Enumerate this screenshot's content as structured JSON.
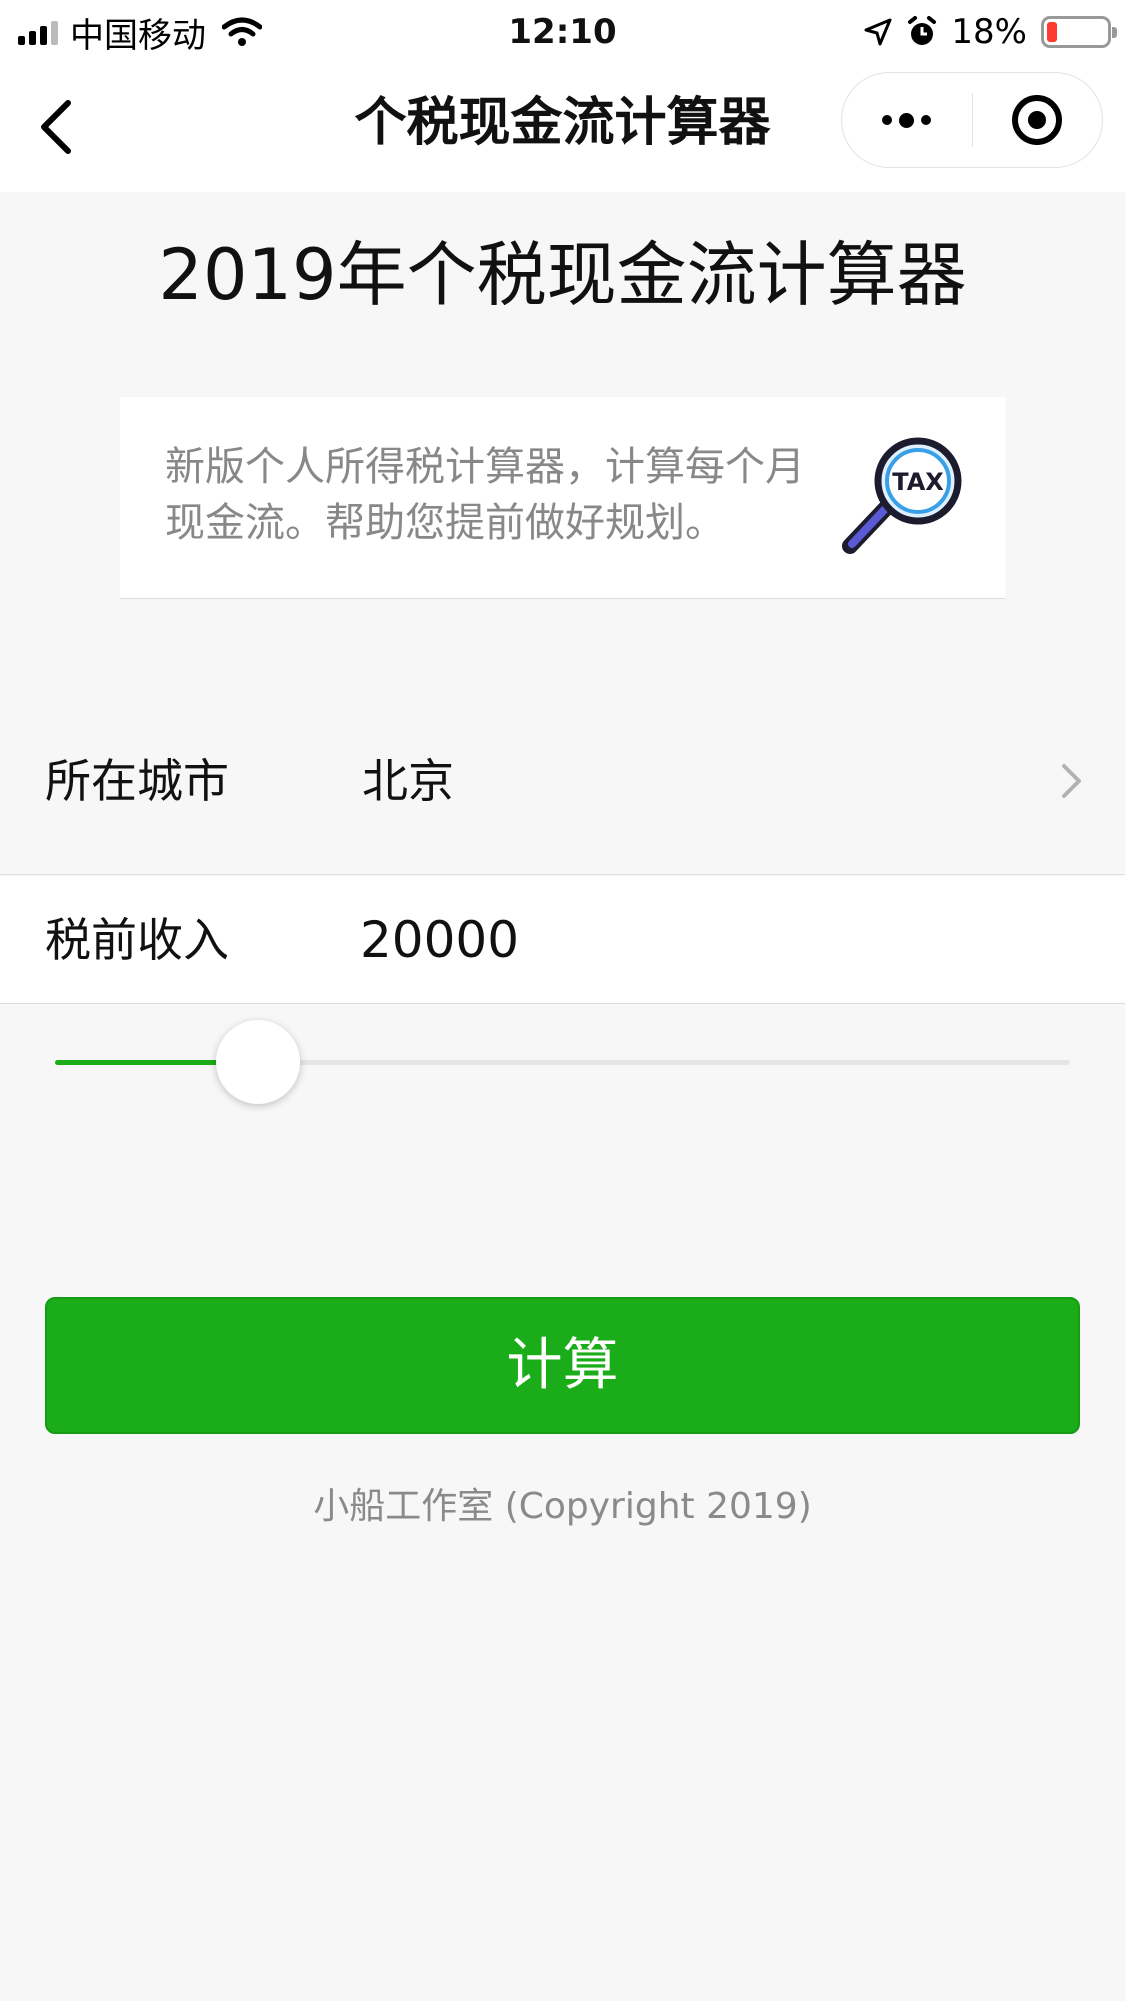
{
  "status_bar": {
    "carrier": "中国移动",
    "time": "12:10",
    "battery_percent": "18%",
    "battery_level": 0.18,
    "signal_bars": 3,
    "icons": [
      "signal-icon",
      "wifi-icon",
      "location-arrow-icon",
      "alarm-icon",
      "battery-icon"
    ]
  },
  "nav": {
    "title": "个税现金流计算器",
    "icons": [
      "back-icon",
      "more-icon",
      "close-target-icon"
    ]
  },
  "main": {
    "heading": "2019年个税现金流计算器",
    "intro": {
      "text": "新版个人所得税计算器，计算每个月现金流。帮助您提前做好规划。",
      "icon": "tax-magnifier-icon",
      "icon_label": "TAX"
    },
    "city": {
      "label": "所在城市",
      "value": "北京"
    },
    "income": {
      "label": "税前收入",
      "value": "20000"
    },
    "slider": {
      "fraction": 0.2
    },
    "calculate_label": "计算",
    "copyright": "小船工作室 (Copyright 2019)"
  },
  "colors": {
    "accent": "#1aad19",
    "background": "#f7f7f7",
    "battery_low": "#ff3b30"
  }
}
